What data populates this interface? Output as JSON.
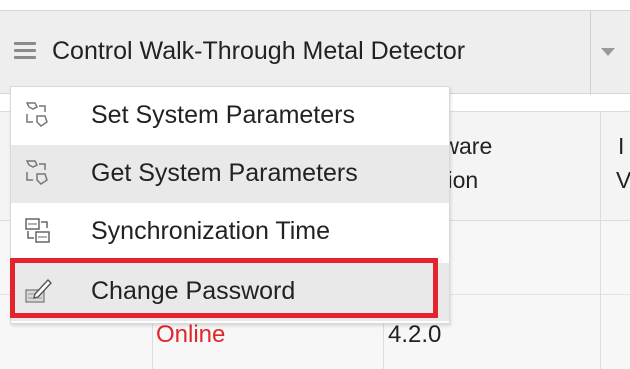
{
  "toolbar": {
    "title": "Control Walk-Through Metal Detector",
    "menu_icon": "hamburger-icon",
    "dropdown_icon": "caret-down-icon"
  },
  "menu": {
    "items": [
      {
        "label": "Set System Parameters",
        "icon": "parameters-icon"
      },
      {
        "label": "Get System Parameters",
        "icon": "parameters-icon"
      },
      {
        "label": "Synchronization Time",
        "icon": "sync-time-icon"
      },
      {
        "label": "Change Password",
        "icon": "edit-password-icon"
      }
    ]
  },
  "table": {
    "partial_header_software_line1": "tware",
    "partial_header_software_line2": "sion",
    "partial_header_next_line1": "I",
    "partial_header_next_line2": "V",
    "row_status": "Online",
    "row_version": "4.2.0"
  },
  "colors": {
    "highlight": "#e5232e",
    "status_offline": "#e0262b"
  }
}
